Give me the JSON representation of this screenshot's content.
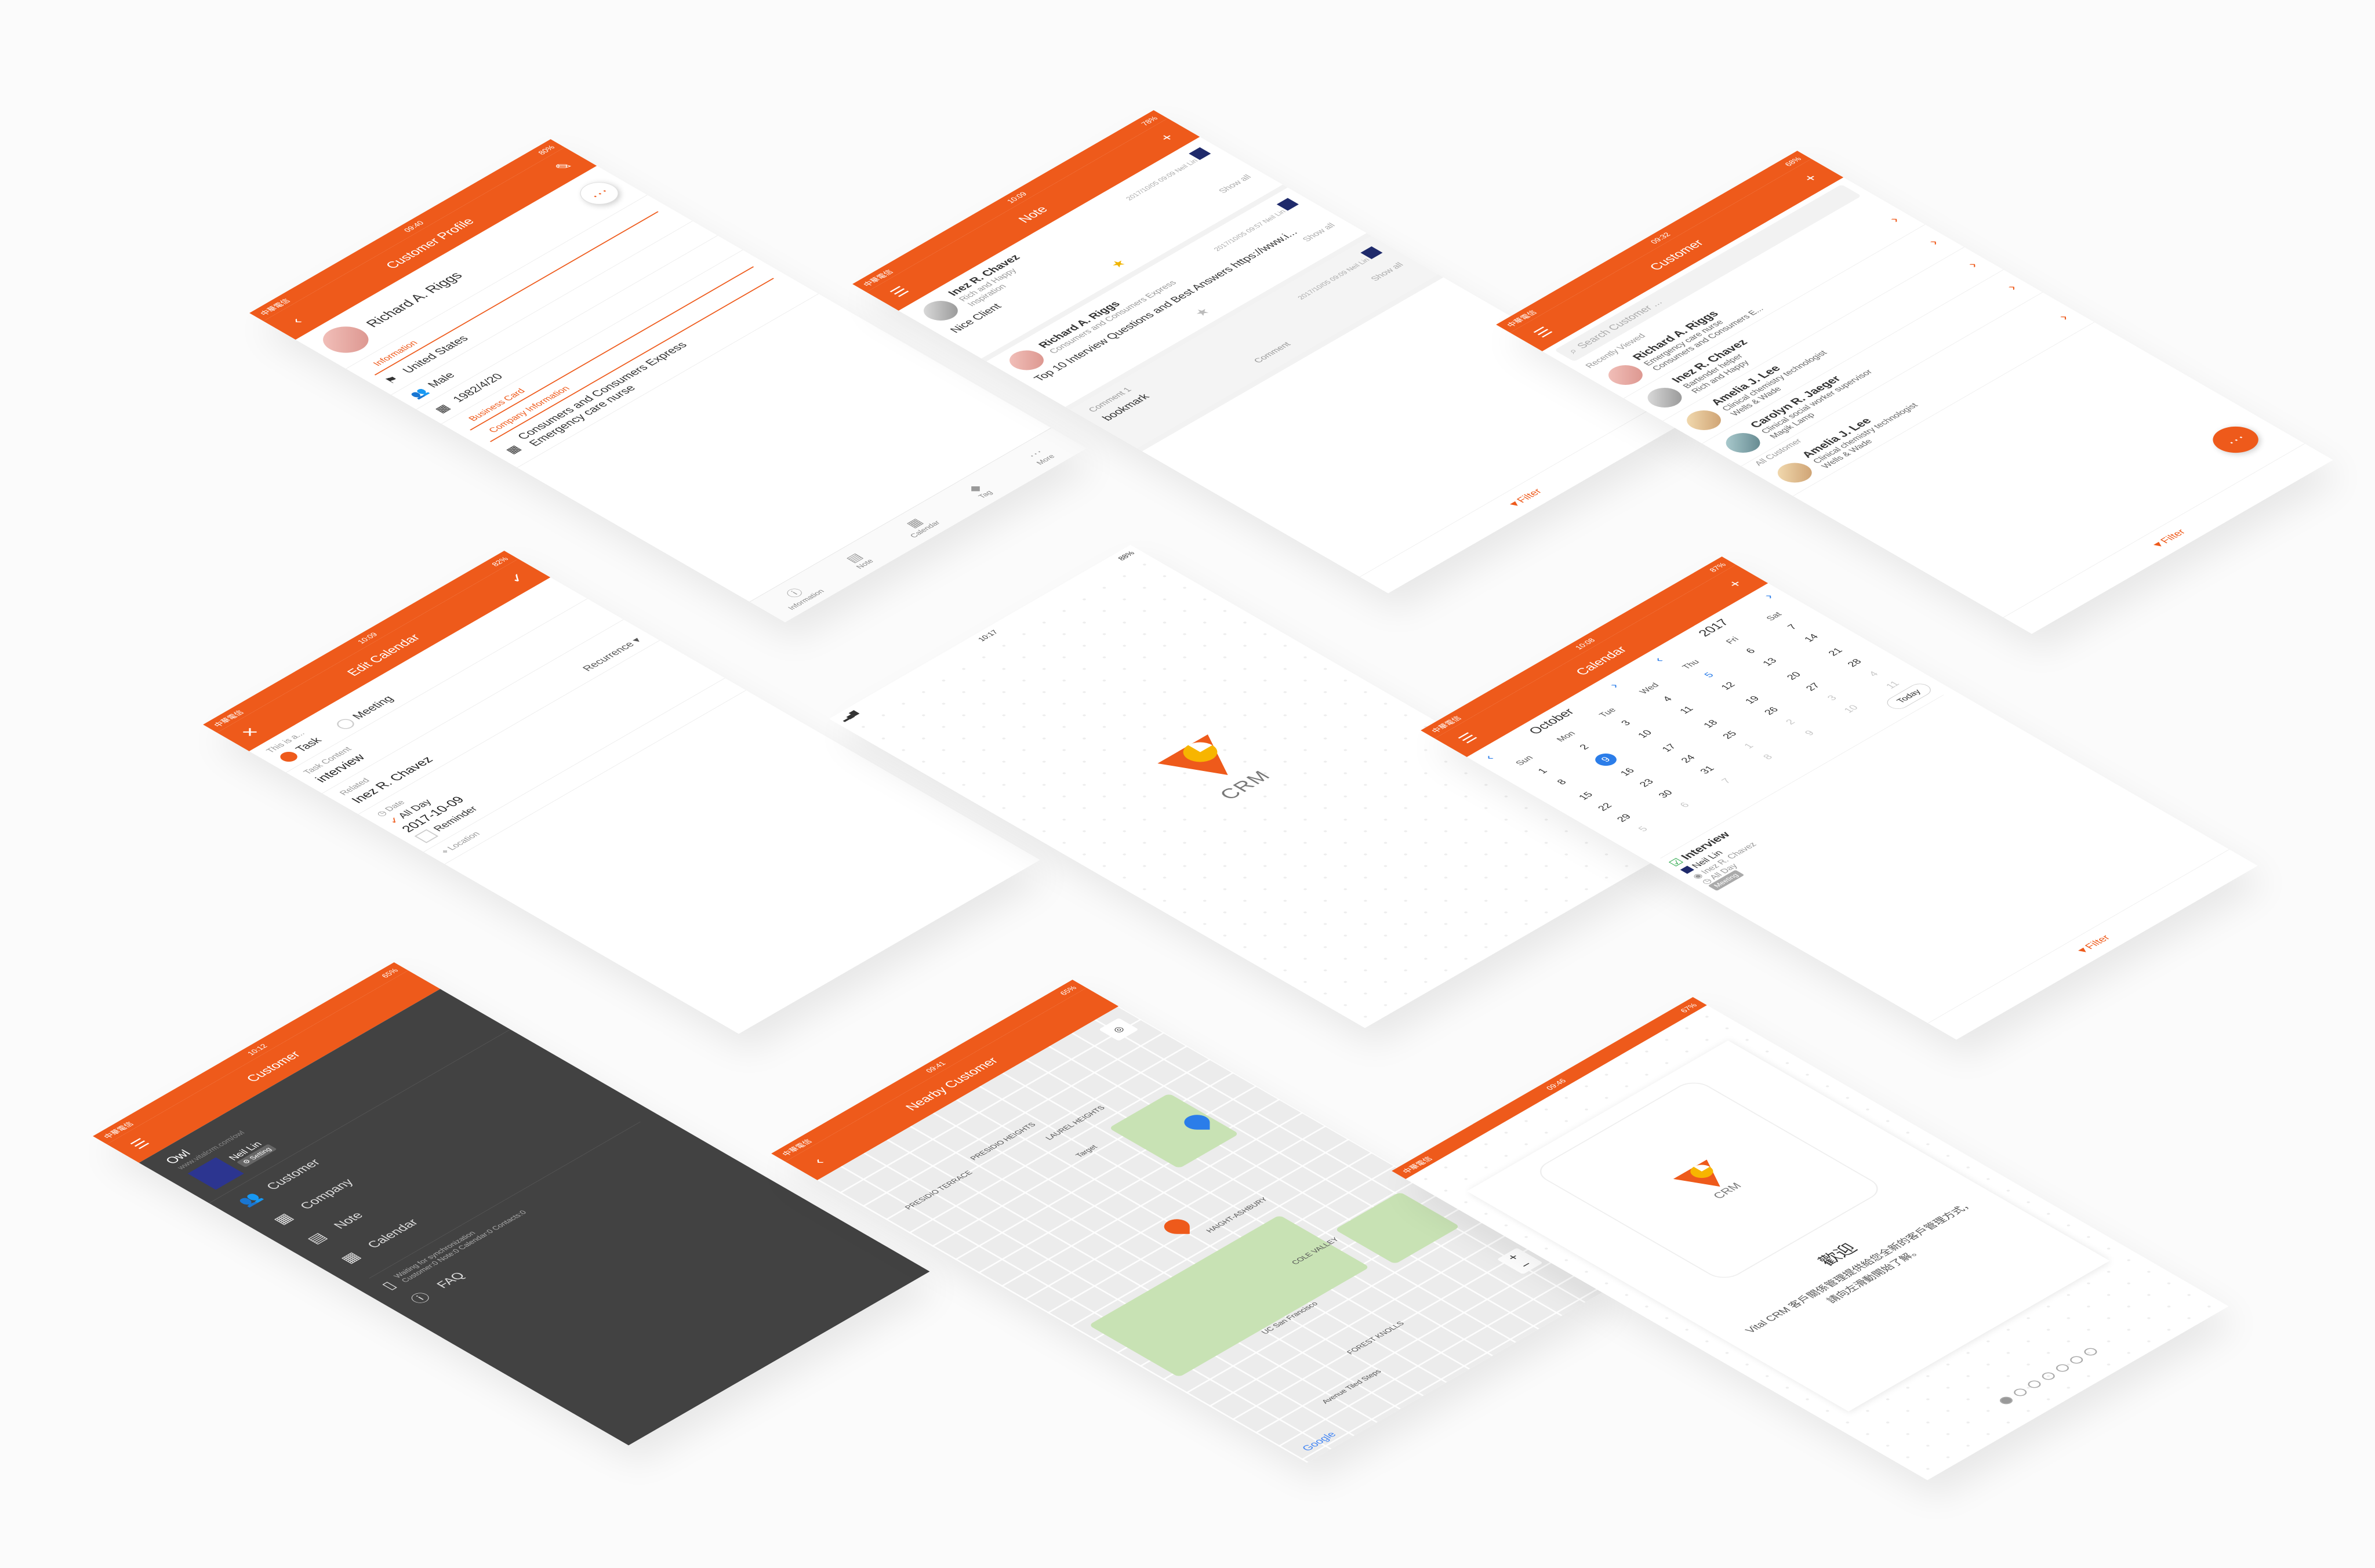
{
  "brand": {
    "accent": "#ee5a1b",
    "name": "CRM"
  },
  "profile": {
    "carrier": "中華電信",
    "time": "09:40",
    "battery": "80%",
    "title": "Customer Profile",
    "name": "Richard A. Riggs",
    "section_info": "Information",
    "country": "United States",
    "gender": "Male",
    "birthday": "1982/4/20",
    "section_business": "Business Card",
    "section_company": "Company Information",
    "company": "Consumers and Consumers Express",
    "job": "Emergency care nurse",
    "tabs": [
      "Information",
      "Note",
      "Calendar",
      "Tag",
      "More"
    ],
    "more_icon": "ellipsis-icon"
  },
  "note": {
    "carrier": "中華電信",
    "time": "10:09",
    "battery": "78%",
    "title": "Note",
    "cards": [
      {
        "name": "Inez R. Chavez",
        "sub": "Rich and Happy",
        "tag": "Inspiration",
        "text": "Nice Client",
        "meta": "2017/10/05 09:09",
        "owner": "Neil Lin",
        "showall": "Show all"
      },
      {
        "name": "Richard A. Riggs",
        "sub": "Consumers and Consumers Express",
        "tag": "",
        "text": "Top 10 Interview Questions and Best Answers https://www.i...",
        "meta": "2017/10/05 09:57",
        "owner": "Neil Lin",
        "showall": "Show all"
      },
      {
        "name": "",
        "sub": "",
        "tag": "Comment 1",
        "text": "bookmark",
        "meta": "2017/10/05 09:09",
        "owner": "Neil Lin",
        "showall": "Show all"
      }
    ],
    "comment": "Comment",
    "filter": "Filter"
  },
  "customer": {
    "carrier": "中華電信",
    "time": "09:32",
    "battery": "68%",
    "title": "Customer",
    "search_placeholder": "Search Customer ...",
    "recent_label": "Recently Viewed",
    "all_label": "All Customer",
    "items": [
      {
        "name": "Richard A. Riggs",
        "line1": "Emergency care nurse",
        "line2": "Consumers and Consumers E..."
      },
      {
        "name": "Inez R. Chavez",
        "line1": "Bartender helper",
        "line2": "Rich and Happy"
      },
      {
        "name": "Amelia J. Lee",
        "line1": "Clinical chemistry technologist",
        "line2": "Wells & Wade"
      },
      {
        "name": "Carolyn R. Jaeger",
        "line1": "Clinical social worker supervisor",
        "line2": "Magik Lamp"
      },
      {
        "name": "Amelia J. Lee",
        "line1": "Clinical chemistry technologist",
        "line2": "Wells & Wade"
      }
    ],
    "filter": "Filter"
  },
  "edit": {
    "carrier": "中華電信",
    "time": "10:09",
    "battery": "82%",
    "title": "Edit Calendar",
    "this_is_a": "This is a...",
    "opt_task": "Task",
    "opt_meeting": "Meeting",
    "content_label": "Task Content",
    "content_value": "interview",
    "related_label": "Related",
    "related_value": "Inez R. Chavez",
    "recurrence": "Recurrence",
    "date_label": "Date",
    "allday": "All Day",
    "date_value": "2017-10-09",
    "reminder": "Reminder",
    "location": "Location"
  },
  "splash": {
    "time": "10:17",
    "battery": "88%",
    "logo_text": "CRM"
  },
  "calendar": {
    "carrier": "中華電信",
    "time": "10:08",
    "battery": "87%",
    "title": "Calendar",
    "month": "October",
    "year": "2017",
    "dow": [
      "Sun",
      "Mon",
      "Tue",
      "Wed",
      "Thu",
      "Fri",
      "Sat"
    ],
    "days": [
      "1",
      "2",
      "3",
      "4",
      "5",
      "6",
      "7",
      "8",
      "9",
      "10",
      "11",
      "12",
      "13",
      "14",
      "15",
      "16",
      "17",
      "18",
      "19",
      "20",
      "21",
      "22",
      "23",
      "24",
      "25",
      "26",
      "27",
      "28",
      "29",
      "30",
      "31",
      "1",
      "2",
      "3",
      "4",
      "5",
      "6",
      "7",
      "8",
      "9",
      "10",
      "11"
    ],
    "today_btn": "Today",
    "event_title": "Interview",
    "event_owner": "Neil Lin",
    "event_related": "Inez R. Chavez",
    "event_allday": "All Day",
    "event_tag": "Meeting",
    "filter": "Filter"
  },
  "menu": {
    "carrier": "中華電信",
    "time": "10:12",
    "battery": "65%",
    "title": "Customer",
    "org": "Owl",
    "org_url": "www.vitalcrm.com/owl",
    "user": "Neil Lin",
    "role": "Setting",
    "items": [
      {
        "label": "Customer",
        "icon": "people-icon"
      },
      {
        "label": "Company",
        "icon": "building-icon"
      },
      {
        "label": "Note",
        "icon": "note-icon"
      },
      {
        "label": "Calendar",
        "icon": "calendar-icon"
      }
    ],
    "sync_line1": "Waiting for synchronization",
    "sync_line2": "Customer:0 Note:0 Calendar:0 Contacts:0",
    "faq": "FAQ"
  },
  "map": {
    "carrier": "中華電信",
    "time": "09:41",
    "battery": "65%",
    "title": "Nearby Customer",
    "labels": [
      "PRESIDIO TERRACE",
      "PRESIDIO HEIGHTS",
      "LAUREL HEIGHTS",
      "Target",
      "HAIGHT-ASHBURY",
      "COLE VALLEY",
      "UC San Francisco",
      "FOREST KNOLLS",
      "Avenue Tiled Steps",
      "Google"
    ]
  },
  "welcome": {
    "carrier": "中華電信",
    "time": "09:46",
    "battery": "67%",
    "logo_text": "CRM",
    "title": "歡迎",
    "text": "Vital CRM 客戶關係管理提供給您全新的客戶管理方式，請向左滑動開始了解。",
    "pages": 7
  }
}
